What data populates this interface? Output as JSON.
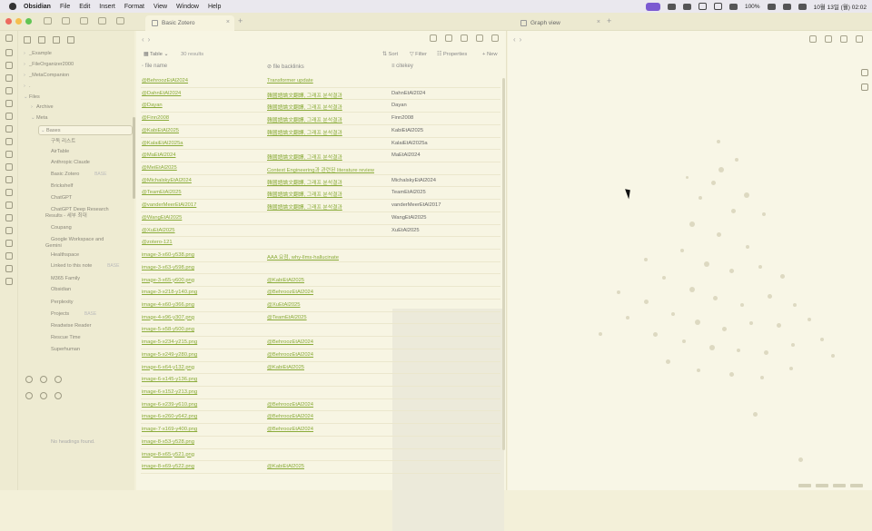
{
  "menubar": {
    "app": "Obsidian",
    "items": [
      "File",
      "Edit",
      "Insert",
      "Format",
      "View",
      "Window",
      "Help"
    ],
    "status_battery": "100%",
    "status_datetime": "10월 13일 (월) 02:02"
  },
  "tabs": {
    "main_tab": "Basic Zotero",
    "graph_tab": "Graph view"
  },
  "sidebar": {
    "items": [
      {
        "label": "_Example",
        "indent": 1,
        "arrow": "›"
      },
      {
        "label": "_FileOrganizer2000",
        "indent": 1,
        "arrow": "›"
      },
      {
        "label": "_MetaCompanion",
        "indent": 1,
        "arrow": "›"
      },
      {
        "label": ".",
        "indent": 1,
        "arrow": "›"
      },
      {
        "label": "Files",
        "indent": 1,
        "arrow": "⌄"
      },
      {
        "label": "Archive",
        "indent": 2,
        "arrow": "›"
      },
      {
        "label": "Meta",
        "indent": 2,
        "arrow": "⌄"
      },
      {
        "label": "Bases",
        "indent": 3,
        "arrow": "⌄",
        "selected": true
      },
      {
        "label": "구독 리스트",
        "indent": 4,
        "arrow": ""
      },
      {
        "label": "AirTable",
        "indent": 4,
        "arrow": ""
      },
      {
        "label": "Anthropic Claude",
        "indent": 4,
        "arrow": ""
      },
      {
        "label": "Basic Zotero",
        "indent": 4,
        "arrow": "",
        "badge": "BASE"
      },
      {
        "label": "Brickshelf",
        "indent": 4,
        "arrow": ""
      },
      {
        "label": "ChatGPT",
        "indent": 4,
        "arrow": ""
      },
      {
        "label": "ChatGPT Deep Research Results - 세부 최대",
        "indent": 4,
        "arrow": ""
      },
      {
        "label": "Coupang",
        "indent": 4,
        "arrow": ""
      },
      {
        "label": "Google Workspace and Gemini",
        "indent": 4,
        "arrow": ""
      },
      {
        "label": "Healthspace",
        "indent": 4,
        "arrow": ""
      },
      {
        "label": "Linked to this note",
        "indent": 4,
        "arrow": "",
        "badge": "BASE"
      },
      {
        "label": "M365 Family",
        "indent": 4,
        "arrow": ""
      },
      {
        "label": "Obsidian",
        "indent": 4,
        "arrow": ""
      },
      {
        "label": "Perplexity",
        "indent": 4,
        "arrow": ""
      },
      {
        "label": "Projects",
        "indent": 4,
        "arrow": "",
        "badge": "BASE"
      },
      {
        "label": "Readwise Reader",
        "indent": 4,
        "arrow": ""
      },
      {
        "label": "Rescue Time",
        "indent": 4,
        "arrow": ""
      },
      {
        "label": "Superhuman",
        "indent": 4,
        "arrow": ""
      }
    ],
    "no_headings": "No headings found."
  },
  "base": {
    "view_label": "Table",
    "result_count": "30 results",
    "sort_label": "Sort",
    "filter_label": "Filter",
    "properties_label": "Properties",
    "new_label": "New",
    "columns": [
      "file name",
      "file backlinks",
      "citekey"
    ],
    "rows": [
      [
        "@BehroozEtAl2024",
        "Transformer update",
        ""
      ],
      [
        "@DahnEtAl2024",
        "韓國語論文翻譯, 그래프 분석결과",
        "DahnEtAl2024"
      ],
      [
        "@Dayan",
        "韓國語論文翻譯, 그래프 분석결과",
        "Dayan"
      ],
      [
        "@Finn2008",
        "韓國語論文翻譯, 그래프 분석결과",
        "Finn2008"
      ],
      [
        "@KabiEtAl2025",
        "韓國語論文翻譯, 그래프 분석결과",
        "KabiEtAl2025"
      ],
      [
        "@KalaiEtAl2025a",
        "",
        "KalaiEtAl2025a"
      ],
      [
        "@MaEtAl2024",
        "韓國語論文翻譯, 그래프 분석결과",
        "MaEtAl2024"
      ],
      [
        "@MeiEtAl2025",
        "Context Engineering과 관련된 literature review",
        ""
      ],
      [
        "@MichalskyEtAl2024",
        "韓國語論文翻譯, 그래프 분석결과",
        "MichalskyEtAl2024"
      ],
      [
        "@TeamEtAl2025",
        "韓國語論文翻譯, 그래프 분석결과",
        "TeamEtAl2025"
      ],
      [
        "@vanderMeerEtAl2017",
        "韓國語論文翻譯, 그래프 분석결과",
        "vanderMeerEtAl2017"
      ],
      [
        "@WangEtAl2025",
        "",
        "WangEtAl2025"
      ],
      [
        "@XuEtAl2025",
        "",
        "XuEtAl2025"
      ],
      [
        "@zotero-121",
        "",
        ""
      ],
      [
        "image-3-x60-y538.png",
        "AAA 요점, why-llms-hallucinate",
        ""
      ],
      [
        "image-3-x63-y598.png",
        "",
        ""
      ],
      [
        "image-3-x65-y600.png",
        "@KabiEtAl2025",
        ""
      ],
      [
        "image-3-x218-y140.png",
        "@BehroozEtAl2024",
        ""
      ],
      [
        "image-4-x60-y366.png",
        "@XuEtAl2025",
        ""
      ],
      [
        "image-4-x96-y307.png",
        "@TeamEtAl2025",
        ""
      ],
      [
        "image-5-x58-y500.png",
        "",
        ""
      ],
      [
        "image-5-x234-y215.png",
        "@BehroozEtAl2024",
        ""
      ],
      [
        "image-5-x249-y280.png",
        "@BehroozEtAl2024",
        ""
      ],
      [
        "image-6-x64-y132.png",
        "@KabiEtAl2025",
        ""
      ],
      [
        "image-6-x145-y136.png",
        "",
        ""
      ],
      [
        "image-6-x152-y213.png",
        "",
        ""
      ],
      [
        "image-6-x239-y610.png",
        "@BehroozEtAl2024",
        ""
      ],
      [
        "image-6-x260-y642.png",
        "@BehroozEtAl2024",
        ""
      ],
      [
        "image-7-x169-y400.png",
        "@BehroozEtAl2024",
        ""
      ],
      [
        "image-8-x53-y528.png",
        "",
        ""
      ],
      [
        "image-8-x65-y521.png",
        "",
        ""
      ],
      [
        "image-8-x69-y522.png",
        "@KabiEtAl2025",
        ""
      ]
    ]
  },
  "colors": {
    "link": "#8aab39",
    "background": "#f7f5e3",
    "sidebar": "#eeebd2",
    "accent": "#7b5ad1"
  }
}
